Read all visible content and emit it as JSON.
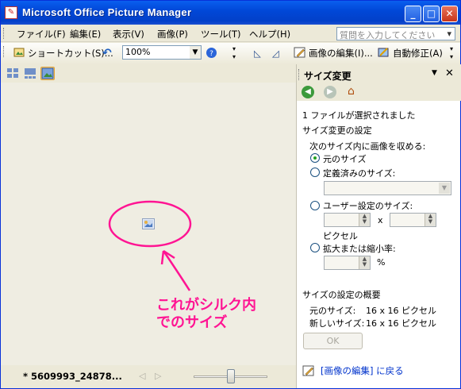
{
  "window": {
    "title": "Microsoft Office Picture Manager",
    "minimize": "_",
    "maximize": "□",
    "close": "✕"
  },
  "menu": {
    "items": [
      "ファイル(F)",
      "編集(E)",
      "表示(V)",
      "画像(P)",
      "ツール(T)",
      "ヘルプ(H)"
    ],
    "help_placeholder": "質問を入力してください"
  },
  "toolbar": {
    "shortcut": "ショートカット(S)...",
    "zoom": "100%",
    "edit_picture": "画像の編集(I)...",
    "auto_correct": "自動修正(A)"
  },
  "canvas": {
    "annotation_line1": "これがシルク内",
    "annotation_line2": "でのサイズ",
    "annotation_color": "#FF1493"
  },
  "status": {
    "file_name": "* 5609993_24878..."
  },
  "pane": {
    "title": "サイズ変更",
    "selected_count": "1 ファイルが選択されました",
    "settings_header": "サイズ変更の設定",
    "fit_label": "次のサイズ内に画像を収める:",
    "opt_original": "元のサイズ",
    "opt_predefined": "定義済みのサイズ:",
    "opt_custom": "ユーザー設定のサイズ:",
    "times": "x",
    "pixels": "ピクセル",
    "opt_percent": "拡大または縮小率:",
    "percent_sign": "%",
    "summary_header": "サイズの設定の概要",
    "orig_label": "元のサイズ:",
    "orig_value": "16 x 16 ピクセル",
    "new_label": "新しいサイズ:",
    "new_value": "16 x 16 ピクセル",
    "ok": "OK",
    "back_link": "[画像の編集] に戻る"
  }
}
